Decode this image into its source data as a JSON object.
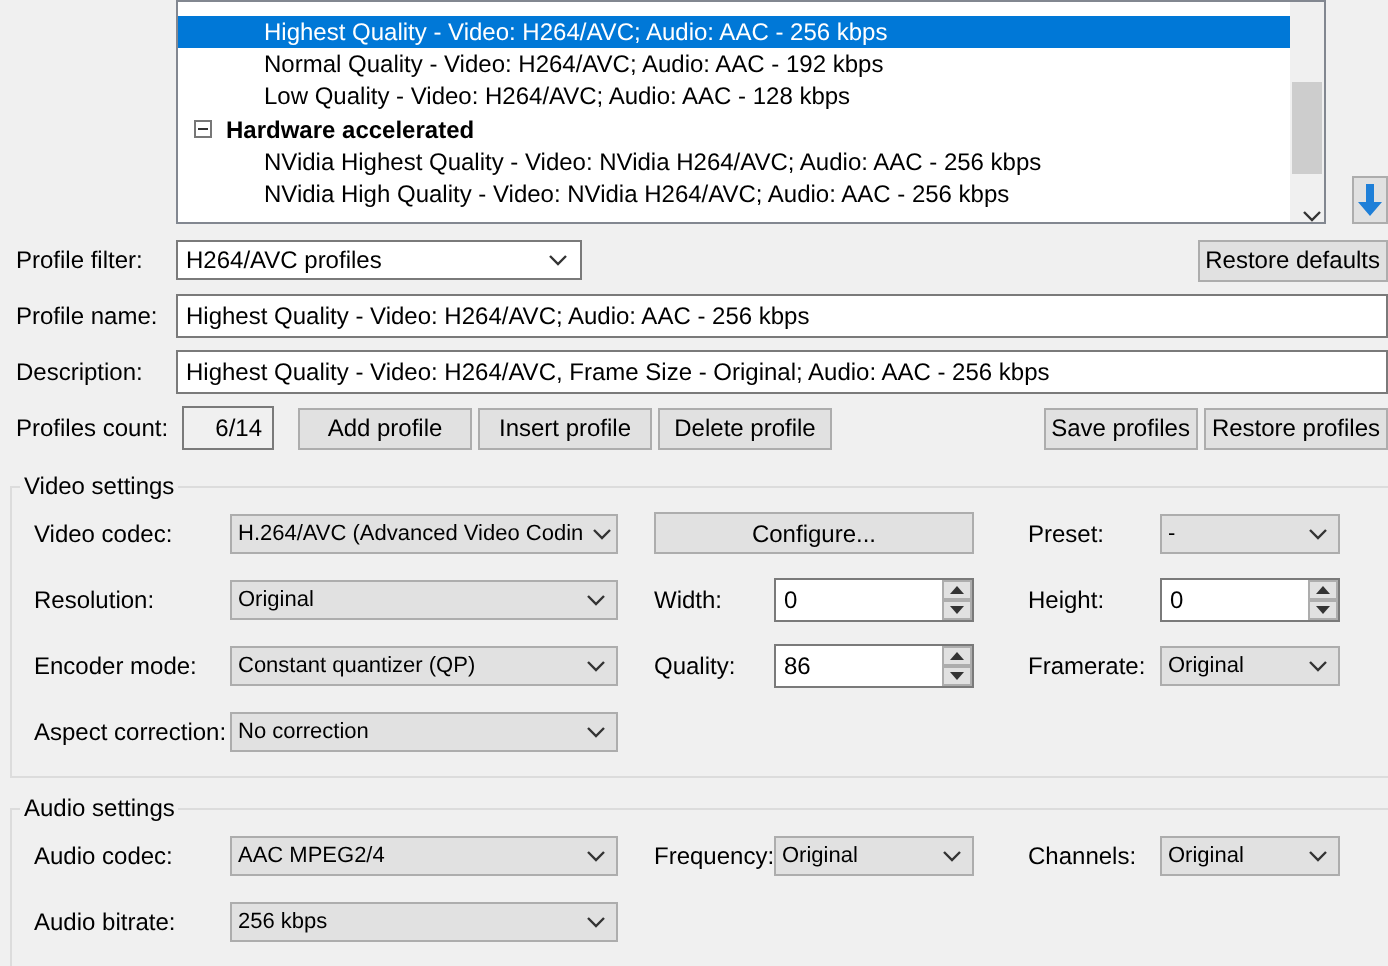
{
  "profile_list": {
    "rows": [
      {
        "kind": "item",
        "label": "Highest Quality - Video: H264/AVC; Audio: AAC - 256 kbps",
        "selected": true
      },
      {
        "kind": "item",
        "label": "Normal Quality - Video: H264/AVC; Audio: AAC - 192 kbps",
        "selected": false
      },
      {
        "kind": "item",
        "label": "Low Quality - Video: H264/AVC; Audio: AAC - 128 kbps",
        "selected": false
      },
      {
        "kind": "group",
        "label": "Hardware accelerated",
        "expanded": true
      },
      {
        "kind": "item",
        "label": "NVidia Highest Quality - Video: NVidia H264/AVC; Audio: AAC - 256 kbps",
        "selected": false
      },
      {
        "kind": "item",
        "label": "NVidia High Quality - Video: NVidia H264/AVC; Audio: AAC - 256 kbps",
        "selected": false
      }
    ]
  },
  "profile_filter": {
    "label": "Profile filter:",
    "value": "H264/AVC profiles"
  },
  "restore_defaults": "Restore defaults",
  "profile_name": {
    "label": "Profile name:",
    "value": "Highest Quality - Video: H264/AVC; Audio: AAC - 256 kbps"
  },
  "description": {
    "label": "Description:",
    "value": "Highest Quality - Video: H264/AVC, Frame Size - Original; Audio: AAC - 256 kbps"
  },
  "profiles_count": {
    "label": "Profiles count:",
    "value": "6/14"
  },
  "profile_buttons": [
    "Add profile",
    "Insert profile",
    "Delete profile"
  ],
  "file_buttons": [
    "Save profiles",
    "Restore profiles"
  ],
  "groups": [
    {
      "title": "Video settings",
      "rows": [
        [
          {
            "label": "Video codec:",
            "kind": "combo",
            "value": "H.264/AVC (Advanced Video Codin"
          },
          {
            "kind": "button",
            "value": "Configure..."
          },
          {
            "label": "Preset:",
            "kind": "combo",
            "value": "-"
          }
        ],
        [
          {
            "label": "Resolution:",
            "kind": "combo",
            "value": "Original"
          },
          {
            "label": "Width:",
            "kind": "spin",
            "value": "0"
          },
          {
            "label": "Height:",
            "kind": "spin",
            "value": "0"
          }
        ],
        [
          {
            "label": "Encoder mode:",
            "kind": "combo",
            "value": "Constant quantizer (QP)"
          },
          {
            "label": "Quality:",
            "kind": "spin",
            "value": "86"
          },
          {
            "label": "Framerate:",
            "kind": "combo",
            "value": "Original"
          }
        ],
        [
          {
            "label": "Aspect correction:",
            "kind": "combo",
            "value": "No correction"
          }
        ]
      ]
    },
    {
      "title": "Audio settings",
      "rows": [
        [
          {
            "label": "Audio codec:",
            "kind": "combo",
            "value": "AAC MPEG2/4"
          },
          {
            "label": "Frequency:",
            "kind": "combo",
            "value": "Original"
          },
          {
            "label": "Channels:",
            "kind": "combo",
            "value": "Original"
          }
        ],
        [
          {
            "label": "Audio bitrate:",
            "kind": "combo",
            "value": "256 kbps"
          }
        ]
      ]
    }
  ]
}
